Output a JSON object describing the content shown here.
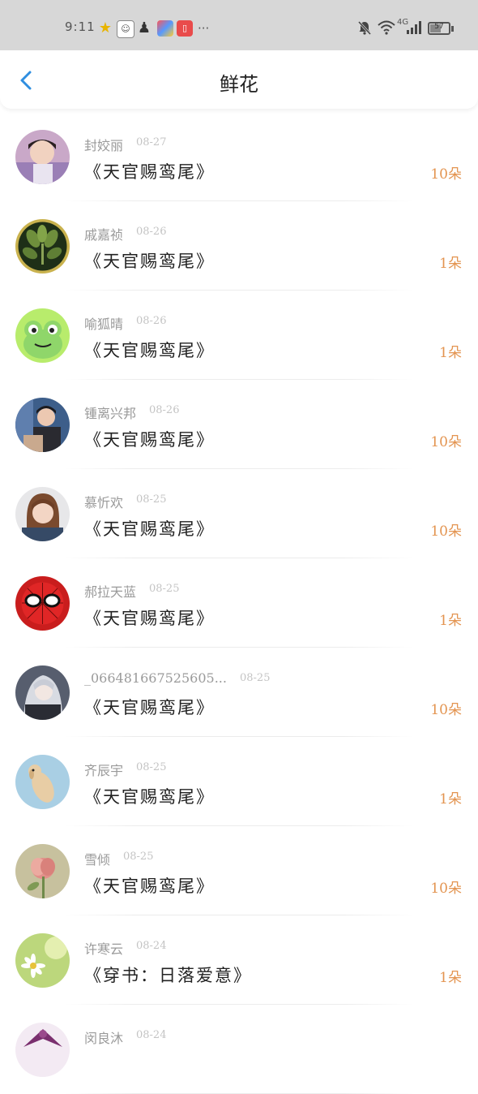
{
  "status_bar": {
    "time": "9:11",
    "network": "4G",
    "battery": "57",
    "battery_level": 0.57,
    "icons": [
      "star-icon",
      "game-icon",
      "qq-icon",
      "app-icon",
      "book-icon",
      "more-icon",
      "bell-muted-icon",
      "wifi-icon",
      "signal-icon",
      "battery-icon"
    ]
  },
  "header": {
    "title": "鲜花",
    "back_icon": "chevron-left-icon",
    "accent_color": "#2f8ee0"
  },
  "colors": {
    "count": "#e39450",
    "name": "#9a9a9a",
    "date": "#c4c4c4"
  },
  "gifts": [
    {
      "name": "封姣丽",
      "date": "08-27",
      "book": "《天官赐鸾尾》",
      "count": "10朵",
      "avatar": "person-avatar"
    },
    {
      "name": "戚嘉祯",
      "date": "08-26",
      "book": "《天官赐鸾尾》",
      "count": "1朵",
      "avatar": "plant-avatar"
    },
    {
      "name": "喻狐晴",
      "date": "08-26",
      "book": "《天官赐鸾尾》",
      "count": "1朵",
      "avatar": "frog-avatar"
    },
    {
      "name": "锺离兴邦",
      "date": "08-26",
      "book": "《天官赐鸾尾》",
      "count": "10朵",
      "avatar": "person-avatar"
    },
    {
      "name": "慕忻欢",
      "date": "08-25",
      "book": "《天官赐鸾尾》",
      "count": "10朵",
      "avatar": "girl-avatar"
    },
    {
      "name": "郝拉天蓝",
      "date": "08-25",
      "book": "《天官赐鸾尾》",
      "count": "1朵",
      "avatar": "spiderman-avatar"
    },
    {
      "name": "_066481667525605...",
      "date": "08-25",
      "book": "《天官赐鸾尾》",
      "count": "10朵",
      "avatar": "anime-avatar"
    },
    {
      "name": "齐辰宇",
      "date": "08-25",
      "book": "《天官赐鸾尾》",
      "count": "1朵",
      "avatar": "dog-avatar"
    },
    {
      "name": "雪倾",
      "date": "08-25",
      "book": "《天官赐鸾尾》",
      "count": "10朵",
      "avatar": "flower-avatar"
    },
    {
      "name": "许寒云",
      "date": "08-24",
      "book": "《穿书：日落爱意》",
      "count": "1朵",
      "avatar": "daisy-avatar"
    },
    {
      "name": "闵良沐",
      "date": "08-24",
      "book": "",
      "count": "",
      "avatar": "purple-avatar"
    }
  ]
}
